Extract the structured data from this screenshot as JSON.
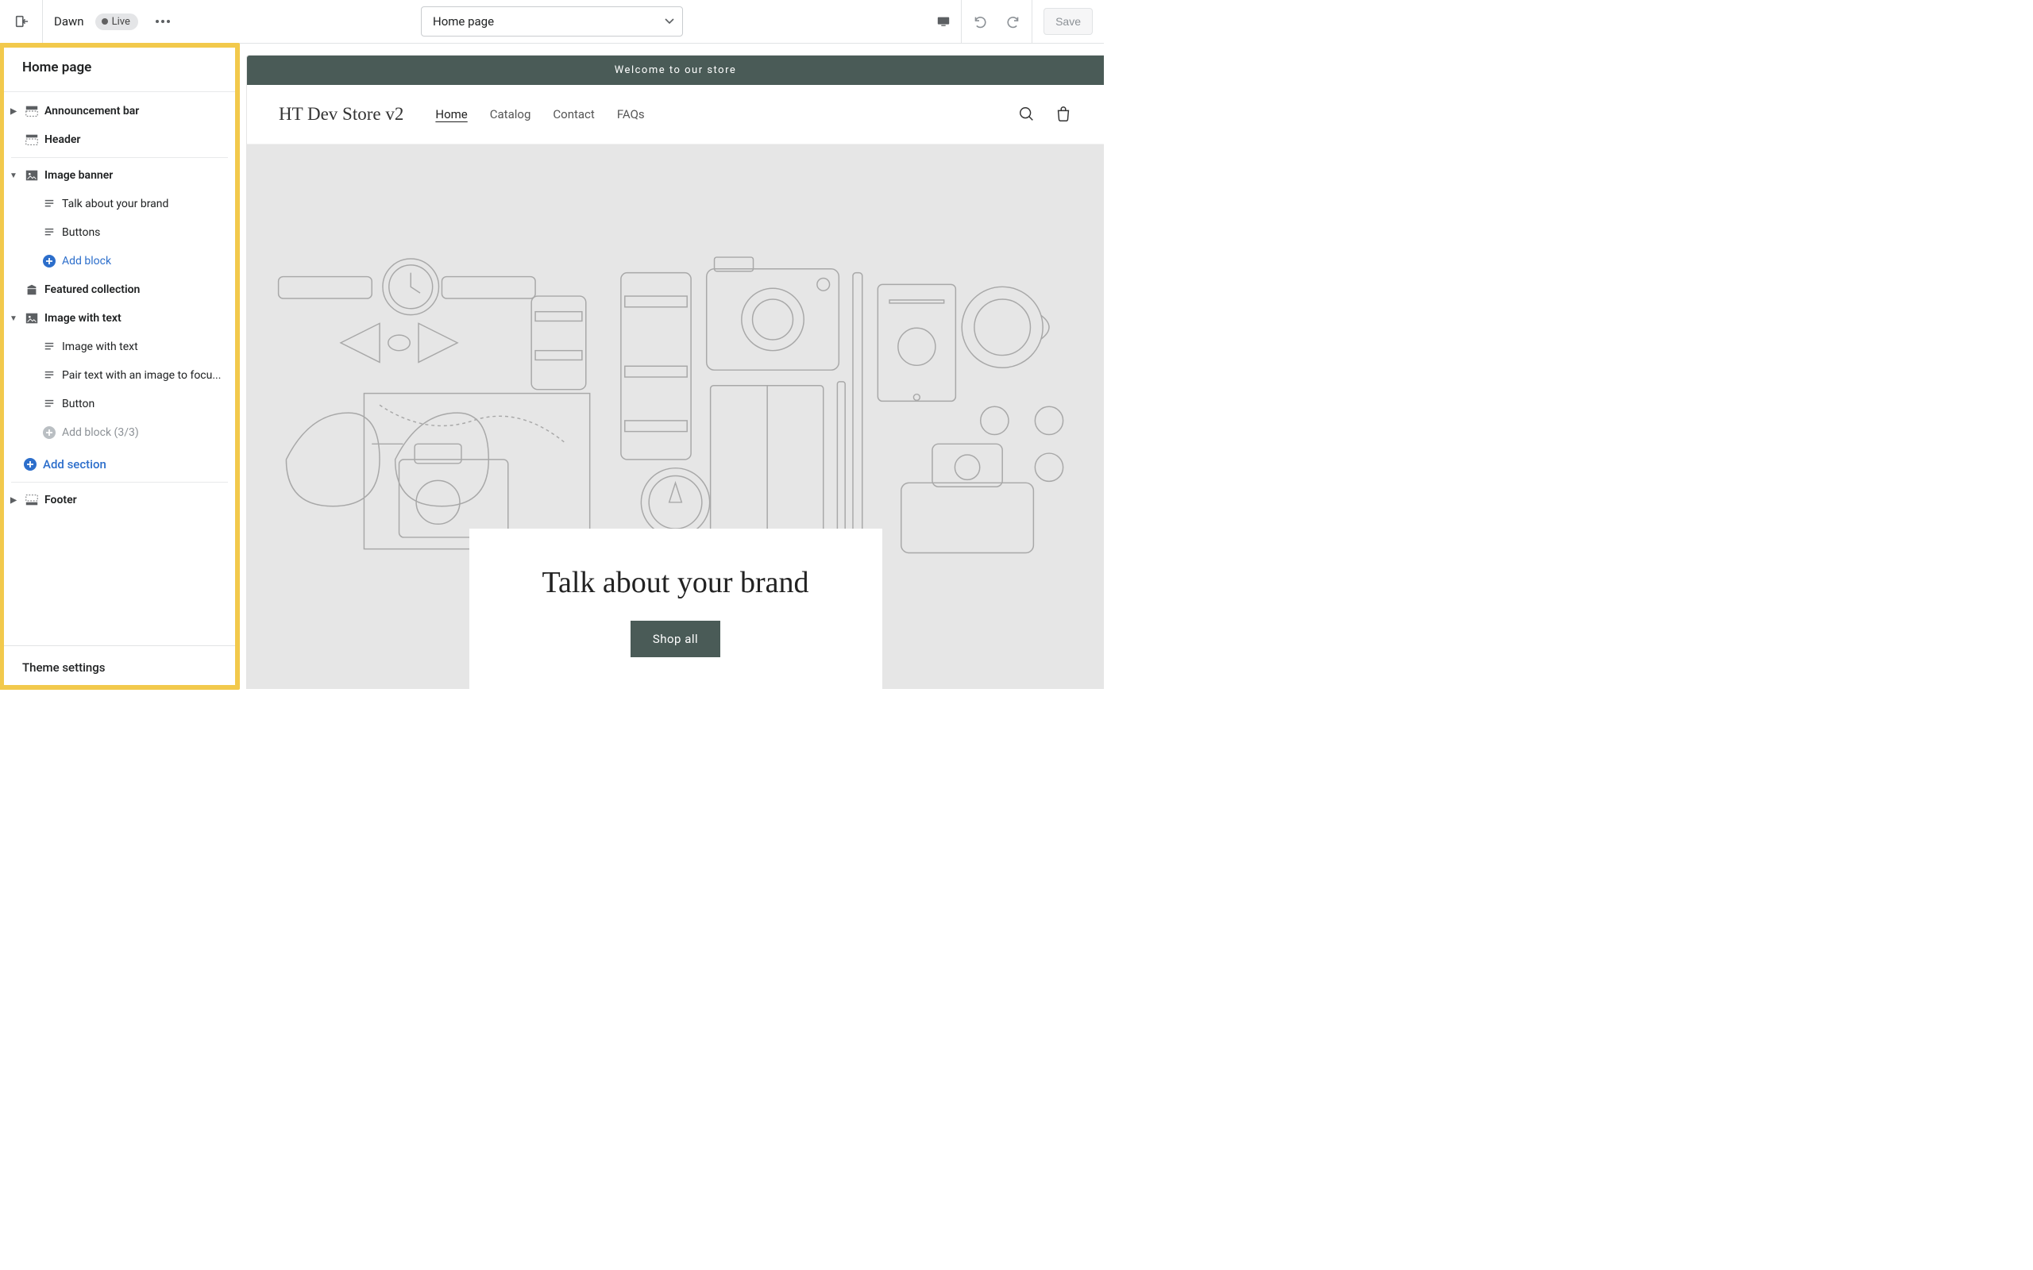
{
  "topbar": {
    "theme_name": "Dawn",
    "status_label": "Live",
    "page_select": "Home page",
    "save_label": "Save"
  },
  "sidebar": {
    "title": "Home page",
    "sections_top": [
      {
        "label": "Announcement bar",
        "icon": "announcement"
      },
      {
        "label": "Header",
        "icon": "header"
      }
    ],
    "image_banner": {
      "label": "Image banner",
      "blocks": [
        "Talk about your brand",
        "Buttons"
      ],
      "add_block": "Add block"
    },
    "featured_collection": {
      "label": "Featured collection"
    },
    "image_with_text": {
      "label": "Image with text",
      "blocks": [
        "Image with text",
        "Pair text with an image to focu...",
        "Button"
      ],
      "add_block": "Add block (3/3)"
    },
    "add_section": "Add section",
    "footer": {
      "label": "Footer"
    },
    "theme_settings": "Theme settings"
  },
  "store": {
    "announcement": "Welcome to our store",
    "title": "HT Dev Store v2",
    "nav": [
      "Home",
      "Catalog",
      "Contact",
      "FAQs"
    ],
    "banner": {
      "heading": "Talk about your brand",
      "button": "Shop all"
    }
  }
}
